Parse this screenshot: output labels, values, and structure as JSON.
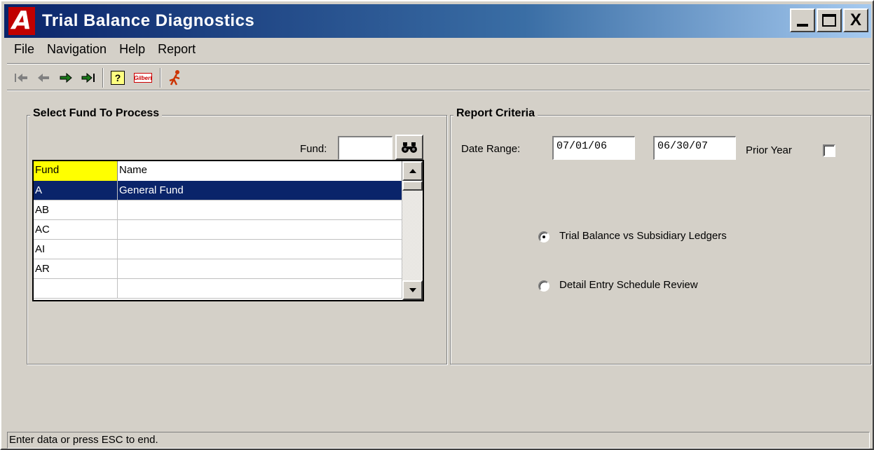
{
  "window": {
    "app_icon_letter": "A",
    "title": "Trial Balance Diagnostics",
    "controls": {
      "close": "X"
    }
  },
  "menu": [
    "File",
    "Navigation",
    "Help",
    "Report"
  ],
  "toolbar": {
    "icons": [
      "first-record-icon",
      "previous-record-icon",
      "next-record-icon",
      "last-record-icon",
      "help-icon",
      "logo-icon",
      "exit-runner-icon"
    ],
    "help_glyph": "?",
    "logo_text": "Gilbert"
  },
  "fund_panel": {
    "title": "Select Fund To Process",
    "fund_label": "Fund:",
    "fund_value": "",
    "columns": [
      "Fund",
      "Name"
    ],
    "rows": [
      {
        "fund": "A",
        "name": "General Fund",
        "selected": true
      },
      {
        "fund": "AB",
        "name": ""
      },
      {
        "fund": "AC",
        "name": ""
      },
      {
        "fund": "AI",
        "name": ""
      },
      {
        "fund": "AR",
        "name": ""
      },
      {
        "fund": "",
        "name": ""
      }
    ],
    "header_color": "#ffff00",
    "selection_color": "#0a246a"
  },
  "criteria_panel": {
    "title": "Report Criteria",
    "date_range_label": "Date Range:",
    "start_date": "07/01/06",
    "end_date": "06/30/07",
    "prior_year_label": "Prior Year",
    "prior_year_checked": false,
    "options": [
      {
        "label": "Trial Balance vs Subsidiary Ledgers",
        "selected": true
      },
      {
        "label": "Detail Entry Schedule Review",
        "selected": false
      }
    ]
  },
  "status_bar": {
    "text": "Enter data or press ESC to end."
  }
}
